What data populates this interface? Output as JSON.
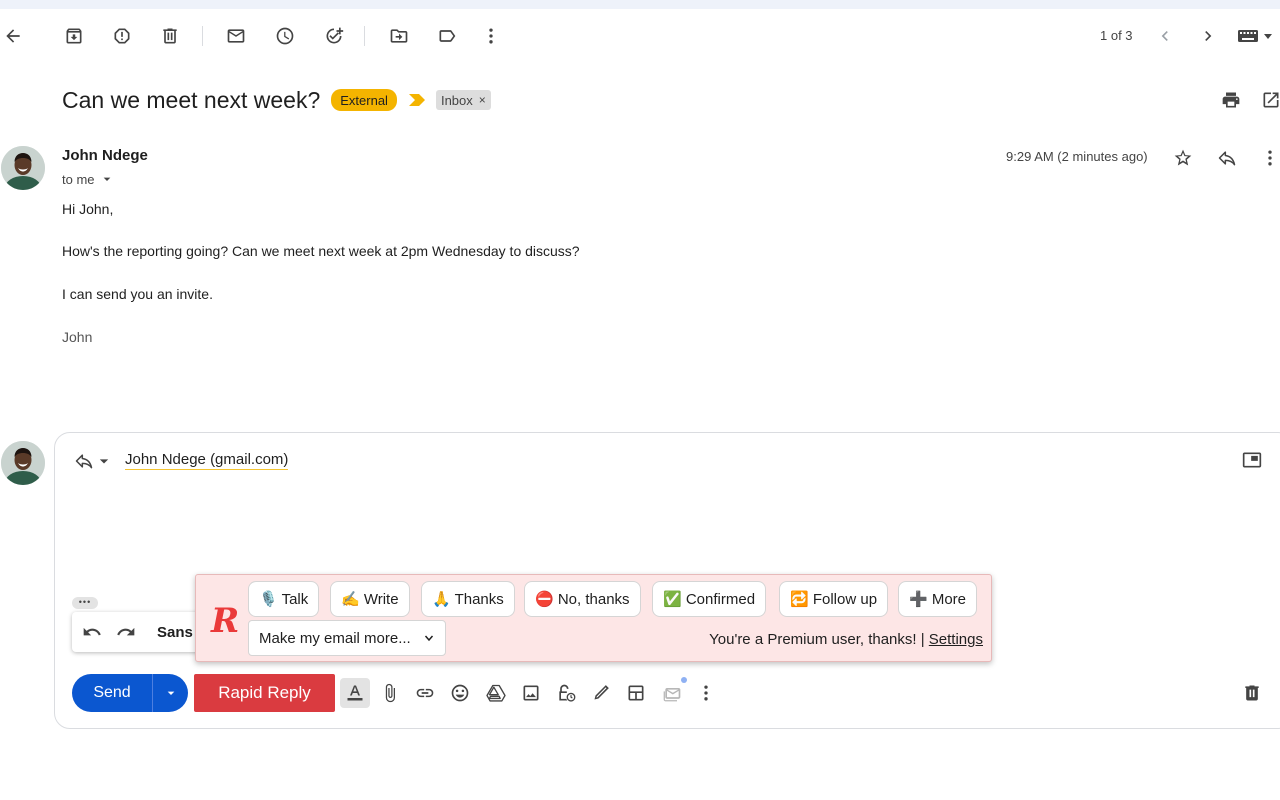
{
  "pager": {
    "text": "1 of 3"
  },
  "thread": {
    "subject": "Can we meet next week?",
    "labels": {
      "external": "External",
      "inbox": "Inbox",
      "inbox_remove": "×"
    }
  },
  "message": {
    "sender_name": "John Ndege",
    "recipient_line": "to me",
    "time": "9:29 AM (2 minutes ago)",
    "body": {
      "greeting": "Hi John,",
      "line1": "How's the reporting going? Can we meet next week at 2pm Wednesday to discuss?",
      "line2": "I can send you an invite.",
      "signature": "John"
    }
  },
  "reply": {
    "recipient": "John Ndege (gmail.com)",
    "dots": "•••",
    "font_label": "Sans",
    "send_label": "Send",
    "rapid_reply_label": "Rapid Reply"
  },
  "rapid_reply": {
    "logo": "R",
    "chips": [
      "🎙️ Talk",
      "✍️ Write",
      "🙏 Thanks",
      "⛔ No, thanks",
      "✅ Confirmed",
      "🔁 Follow up",
      "➕ More"
    ],
    "select_value": "Make my email more...",
    "status_text": "You're a Premium user, thanks! | ",
    "settings_link": "Settings"
  },
  "colors": {
    "accent_blue": "#0b57d0",
    "external_badge": "#f4b400",
    "rapid_reply_red": "#da3b40",
    "panel_bg": "#fde6e6"
  },
  "icons": {
    "toolbar": [
      "back-arrow-icon",
      "archive-icon",
      "report-spam-icon",
      "delete-icon",
      "mark-unread-icon",
      "snooze-icon",
      "add-task-icon",
      "move-to-icon",
      "label-icon",
      "more-vert-icon"
    ],
    "footer": [
      "text-format-icon",
      "attach-icon",
      "link-icon",
      "emoji-icon",
      "drive-icon",
      "photo-icon",
      "confidential-icon",
      "signature-icon",
      "template-icon",
      "layout-icon",
      "more-vert-icon",
      "trash-icon"
    ]
  }
}
